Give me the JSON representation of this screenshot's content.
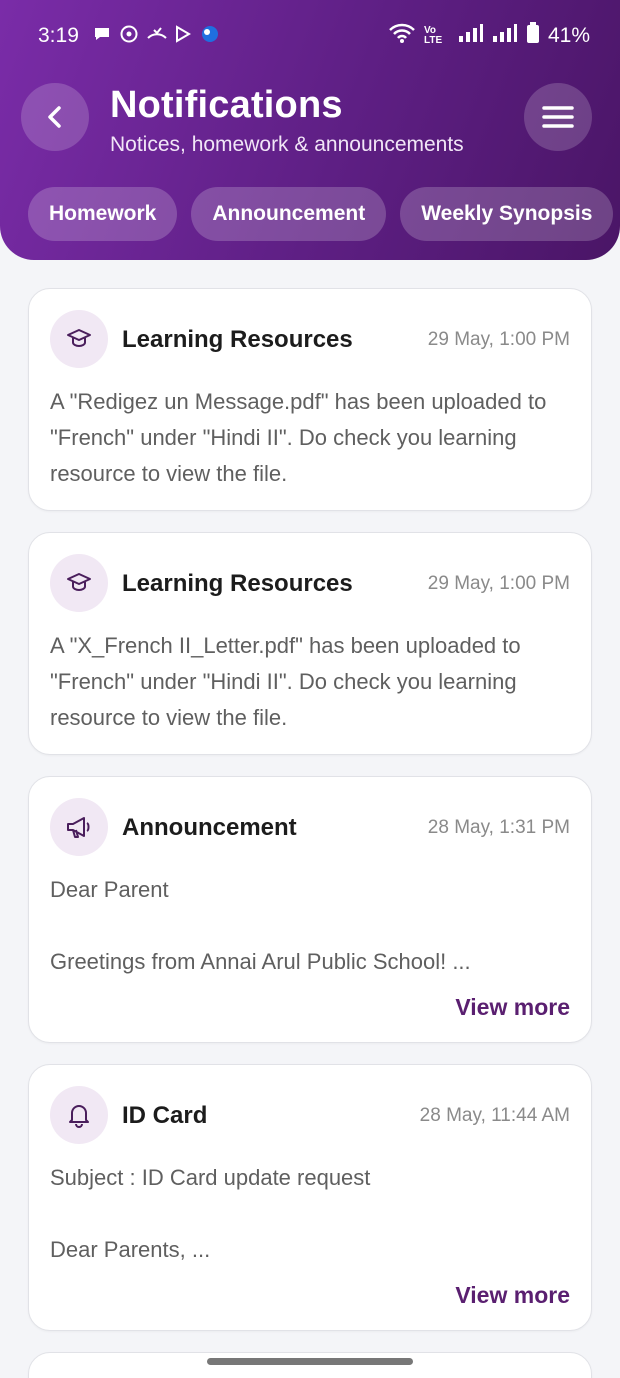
{
  "status_bar": {
    "time": "3:19",
    "battery": "41%",
    "volte": "Vo LTE"
  },
  "header": {
    "title": "Notifications",
    "subtitle": "Notices, homework & announcements"
  },
  "filters": [
    {
      "label": "Homework"
    },
    {
      "label": "Announcement"
    },
    {
      "label": "Weekly Synopsis"
    }
  ],
  "notifications": [
    {
      "title": "Learning Resources",
      "time": "29 May, 1:00 PM",
      "icon": "graduation-cap-icon",
      "body": [
        "A \"Redigez un Message.pdf\" has been uploaded to \"French\" under \"Hindi II\". Do check you learning resource to view the file."
      ]
    },
    {
      "title": "Learning Resources",
      "time": "29 May, 1:00 PM",
      "icon": "graduation-cap-icon",
      "body": [
        "A \"X_French II_Letter.pdf\" has been uploaded to \"French\" under \"Hindi II\". Do check you learning resource to view the file."
      ]
    },
    {
      "title": "Announcement",
      "time": "28 May, 1:31 PM",
      "icon": "megaphone-icon",
      "line1": "Dear Parent",
      "line2": "Greetings from Annai Arul Public School!  ...",
      "view_more": "View more"
    },
    {
      "title": "ID Card",
      "time": "28 May, 11:44 AM",
      "icon": "bell-icon",
      "line1": "Subject : ID Card update request",
      "line2": "Dear Parents,  ...",
      "view_more": "View more"
    }
  ],
  "colors": {
    "header_start": "#7a2ca8",
    "header_end": "#4a1566",
    "accent": "#5a1f70",
    "icon_bg": "#f1e8f4"
  }
}
